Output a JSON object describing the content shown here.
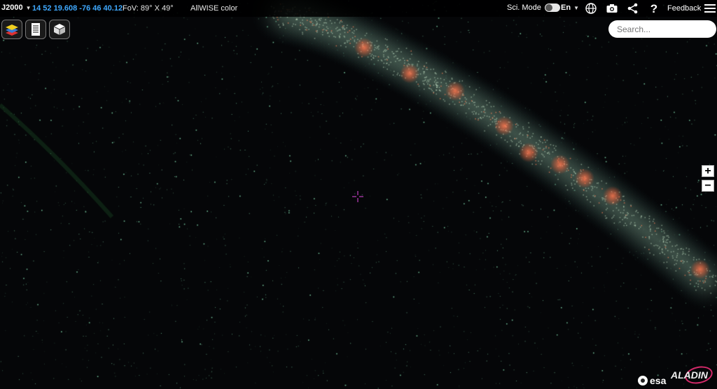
{
  "topbar": {
    "frame": "J2000",
    "coordinates": "14 52 19.608 -76 46 40.12",
    "fov": "FoV: 89° X 49°",
    "survey": "AllWISE color",
    "sci_mode_label": "Sci. Mode",
    "sci_mode_on": false,
    "language": "En",
    "feedback": "Feedback"
  },
  "toolbar": {
    "buttons": [
      "layers-icon",
      "catalog-list-icon",
      "cube-icon"
    ]
  },
  "search": {
    "placeholder": "Search..."
  },
  "zoom": {
    "in_label": "+",
    "out_label": "−"
  },
  "logos": {
    "esa": "esa",
    "aladin": "ALADIN"
  },
  "colors": {
    "coordinates": "#3fa9ff",
    "reticle": "#c040c0",
    "background": "#050608",
    "aladin_ring": "#d42a6a"
  }
}
